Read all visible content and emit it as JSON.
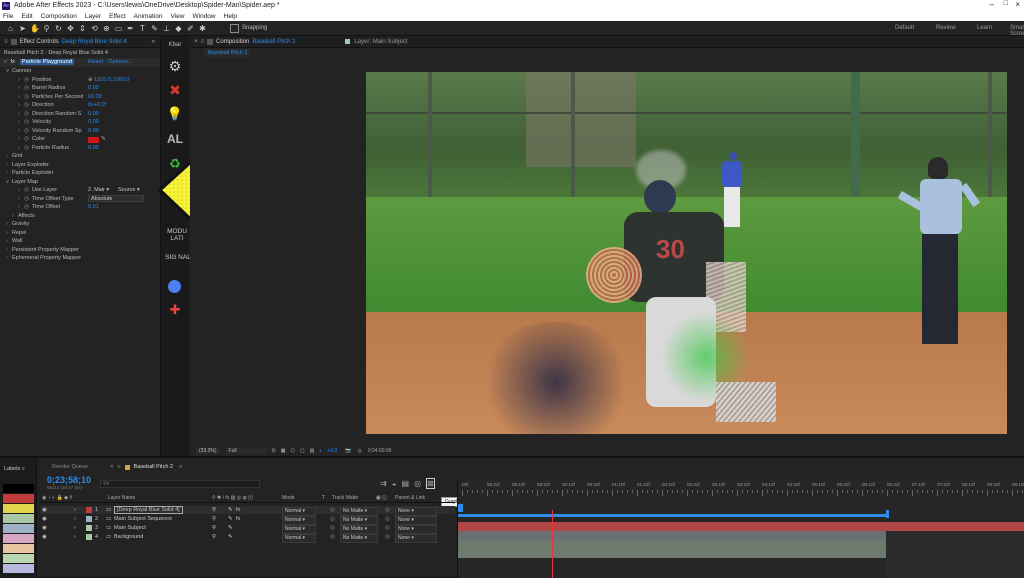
{
  "window": {
    "title": "Adobe After Effects 2023 - C:\\Users\\lewis\\OneDrive\\Desktop\\Spider-Man\\Spider.aep *"
  },
  "menu": [
    "File",
    "Edit",
    "Composition",
    "Layer",
    "Effect",
    "Animation",
    "View",
    "Window",
    "Help"
  ],
  "toolbar": {
    "snapping_label": "Snapping",
    "workspaces": [
      "Default",
      "Review",
      "Learn",
      "Small Screen"
    ]
  },
  "effect_controls": {
    "tab_label": "Effect Controls",
    "layer_name": "Deep Royal Blue Solid 4",
    "breadcrumb": "Baseball Pitch 2 · Deep Royal Blue Solid 4",
    "effect_name": "Particle Playground",
    "reset": "Reset",
    "options": "Options...",
    "params": [
      {
        "label": "Cannon",
        "indent": 1,
        "value": ""
      },
      {
        "label": "Position",
        "indent": 3,
        "value": "1920.0,1080.0"
      },
      {
        "label": "Barrel Radius",
        "indent": 3,
        "value": "0.00"
      },
      {
        "label": "Particles Per Second",
        "indent": 3,
        "value": "60.00"
      },
      {
        "label": "Direction",
        "indent": 3,
        "value": "0x+0.0°"
      },
      {
        "label": "Direction Random S",
        "indent": 3,
        "value": "0.00"
      },
      {
        "label": "Velocity",
        "indent": 3,
        "value": "0.00"
      },
      {
        "label": "Velocity Random Sp",
        "indent": 3,
        "value": "0.00"
      },
      {
        "label": "Color",
        "indent": 3,
        "value": ""
      },
      {
        "label": "Particle Radius",
        "indent": 3,
        "value": "0.00"
      },
      {
        "label": "Grid",
        "indent": 1,
        "value": ""
      },
      {
        "label": "Layer Exploder",
        "indent": 1,
        "value": ""
      },
      {
        "label": "Particle Exploder",
        "indent": 1,
        "value": ""
      },
      {
        "label": "Layer Map",
        "indent": 1,
        "value": ""
      },
      {
        "label": "Use Layer",
        "indent": 3,
        "value": ""
      },
      {
        "label": "Time Offset Type",
        "indent": 3,
        "value": ""
      },
      {
        "label": "Time Offset",
        "indent": 3,
        "value": "0.01"
      },
      {
        "label": "Affects",
        "indent": 2,
        "value": ""
      },
      {
        "label": "Gravity",
        "indent": 1,
        "value": ""
      },
      {
        "label": "Repel",
        "indent": 1,
        "value": ""
      },
      {
        "label": "Wall",
        "indent": 1,
        "value": ""
      },
      {
        "label": "Persistent Property Mapper",
        "indent": 1,
        "value": ""
      },
      {
        "label": "Ephemeral Property Mapper",
        "indent": 1,
        "value": ""
      }
    ],
    "use_layer_value": "2. Mair",
    "use_layer_source": "Source",
    "time_offset_type_value": "Absolute",
    "color_swatch": "#d01818"
  },
  "kbar": {
    "label": "Kbar",
    "text_buttons": [
      "AL",
      "MODU LATI",
      "SIG NAL"
    ]
  },
  "composition": {
    "tab_label": "Composition",
    "comp_name": "Baseball Pitch 2",
    "layer_tab": "Layer: Main Subject",
    "subtab": "Baseball Pitch 2",
    "zoom": "(33.3%)",
    "resolution": "Full",
    "exposure": "+0.0",
    "timecode": "0:24:00:05"
  },
  "timeline": {
    "labels_tab": "Labels",
    "render_queue": "Render Queue",
    "comp_tab": "Baseball Pitch 2",
    "current_time": "0;23;58;10",
    "fps_info": "05113 (29.97 fps)",
    "columns": {
      "name": "Layer Name",
      "mode": "Mode",
      "t": "T",
      "trkmat": "Track Matte",
      "parent": "Parent & Link"
    },
    "tooltip": "Graph Editor",
    "ruler": [
      "00f",
      "58:22f",
      "59:10f",
      "59:22f",
      "00:10f",
      "00:22f",
      "01:10f",
      "01:22f",
      "02:10f",
      "02:22f",
      "03:10f",
      "03:22f",
      "04:10f",
      "04:22f",
      "05:10f",
      "05:22f",
      "06:10f",
      "06:22f",
      "07:10f",
      "07:22f",
      "08:10f",
      "08:22f",
      "09:10f"
    ],
    "layers": [
      {
        "num": "1",
        "name": "[Deep Royal Blue Solid 4]",
        "mode": "Normal",
        "matte": "No Matte",
        "parent": "None",
        "color": "#c23b3b"
      },
      {
        "num": "2",
        "name": "Main Subject Sequence",
        "mode": "Normal",
        "matte": "No Matte",
        "parent": "None",
        "color": "#9fb1c8"
      },
      {
        "num": "3",
        "name": "Main Subject",
        "mode": "Normal",
        "matte": "No Matte",
        "parent": "None",
        "color": "#a9c7a6"
      },
      {
        "num": "4",
        "name": "Background",
        "mode": "Normal",
        "matte": "No Matte",
        "parent": "None",
        "color": "#a9c7a6"
      }
    ],
    "label_colors": [
      "#000000",
      "#c23b3b",
      "#e3d44b",
      "#a9c7a6",
      "#9fb1c8",
      "#d7a6c4",
      "#e8c3a2",
      "#b8d6b0",
      "#b9b9e0"
    ]
  }
}
